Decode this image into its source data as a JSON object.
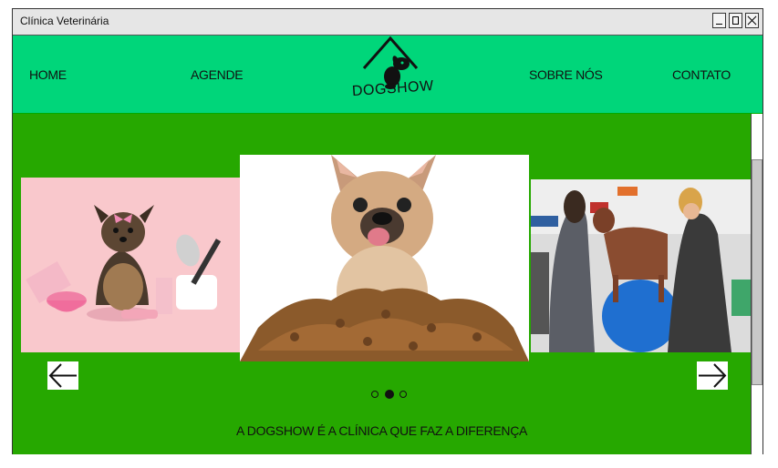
{
  "window": {
    "title": "Clínica Veterinária"
  },
  "nav": {
    "items": [
      {
        "label": "HOME"
      },
      {
        "label": "AGENDE"
      },
      {
        "label": "SOBRE NÓS"
      },
      {
        "label": "CONTATO"
      }
    ]
  },
  "logo": {
    "text": "DOGSHOW"
  },
  "carousel": {
    "slides": [
      {
        "name": "yorkshire-grooming"
      },
      {
        "name": "french-bulldog-kibble"
      },
      {
        "name": "dog-physiotherapy"
      }
    ],
    "dot_count": 3,
    "active_dot": 2
  },
  "tagline": "A DOGSHOW É A CLÍNICA QUE FAZ A DIFERENÇA",
  "colors": {
    "nav_bg": "#00d67a",
    "content_bg": "#26a800",
    "titlebar_bg": "#e6e6e6"
  }
}
